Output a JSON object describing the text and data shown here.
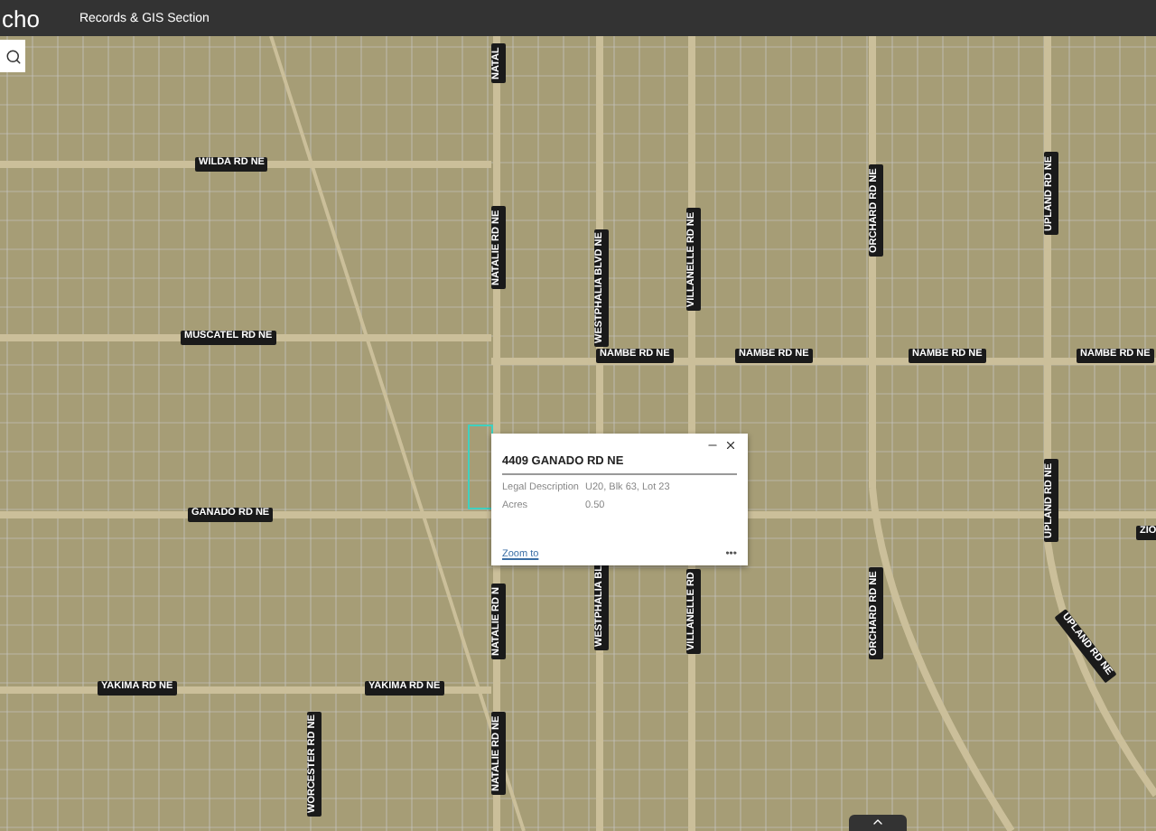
{
  "header": {
    "brand": "cho",
    "title": "Records & GIS Section"
  },
  "road_labels": [
    {
      "text": "WILDA RD NE",
      "kind": "horizontal"
    },
    {
      "text": "MUSCATEL RD NE",
      "kind": "horizontal"
    },
    {
      "text": "GANADO RD NE",
      "kind": "horizontal"
    },
    {
      "text": "YAKIMA RD NE",
      "kind": "horizontal"
    },
    {
      "text": "YAKIMA RD NE",
      "kind": "horizontal"
    },
    {
      "text": "NAMBE RD NE",
      "kind": "horizontal"
    },
    {
      "text": "NAMBE RD NE",
      "kind": "horizontal"
    },
    {
      "text": "NAMBE RD NE",
      "kind": "horizontal"
    },
    {
      "text": "NAMBE RD NE",
      "kind": "horizontal"
    },
    {
      "text": "ZIO",
      "kind": "horizontal"
    },
    {
      "text": "NATAL",
      "kind": "vertical"
    },
    {
      "text": "NATALIE RD NE",
      "kind": "vertical"
    },
    {
      "text": "NATALIE RD N",
      "kind": "vertical"
    },
    {
      "text": "NATALIE RD NE",
      "kind": "vertical"
    },
    {
      "text": "WESTPHALIA BLVD NE",
      "kind": "vertical"
    },
    {
      "text": "WESTPHALIA BL",
      "kind": "vertical"
    },
    {
      "text": "VILLANELLE RD NE",
      "kind": "vertical"
    },
    {
      "text": "VILLANELLE RD",
      "kind": "vertical"
    },
    {
      "text": "ORCHARD RD NE",
      "kind": "vertical"
    },
    {
      "text": "ORCHARD RD NE",
      "kind": "vertical"
    },
    {
      "text": "UPLAND RD NE",
      "kind": "vertical"
    },
    {
      "text": "UPLAND RD NE",
      "kind": "vertical"
    },
    {
      "text": "WORCESTER RD NE",
      "kind": "vertical"
    },
    {
      "text": "UPLAND RD NE",
      "kind": "diagonal"
    }
  ],
  "popup": {
    "title": "4409 GANADO RD NE",
    "fields": [
      {
        "label": "Legal Description",
        "value": "U20, Blk 63, Lot 23"
      },
      {
        "label": "Acres",
        "value": "0.50"
      }
    ],
    "link": "Zoom to",
    "more": "•••"
  }
}
